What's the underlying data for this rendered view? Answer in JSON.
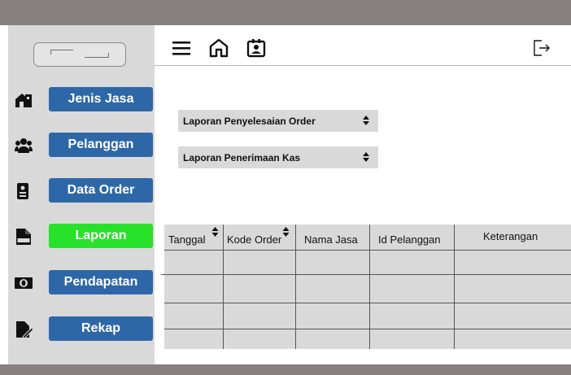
{
  "sidebar": {
    "items": [
      {
        "label": "Jenis Jasa",
        "icon": "house-icon"
      },
      {
        "label": "Pelanggan",
        "icon": "users-icon"
      },
      {
        "label": "Data Order",
        "icon": "order-document-icon"
      },
      {
        "label": "Laporan",
        "icon": "doc-file-icon",
        "active": true
      },
      {
        "label": "Pendapatan",
        "icon": "money-icon"
      },
      {
        "label": "Rekap",
        "icon": "edit-file-icon"
      }
    ]
  },
  "toolbar": {
    "icons": [
      "menu-icon",
      "home-icon",
      "id-card-icon",
      "logout-icon"
    ]
  },
  "reports": {
    "select_1": "Laporan Penyelesaian Order",
    "select_2": "Laporan Penerimaan Kas"
  },
  "table": {
    "headers": [
      "Tanggal",
      "Kode Order",
      "Nama Jasa",
      "Id Pelanggan",
      "Keterangan"
    ],
    "rows": 4
  },
  "colors": {
    "topbar": "#878080",
    "sidebar": "#d9d9d9",
    "nav_button": "#2d67a7",
    "nav_button_active": "#27e12b"
  }
}
